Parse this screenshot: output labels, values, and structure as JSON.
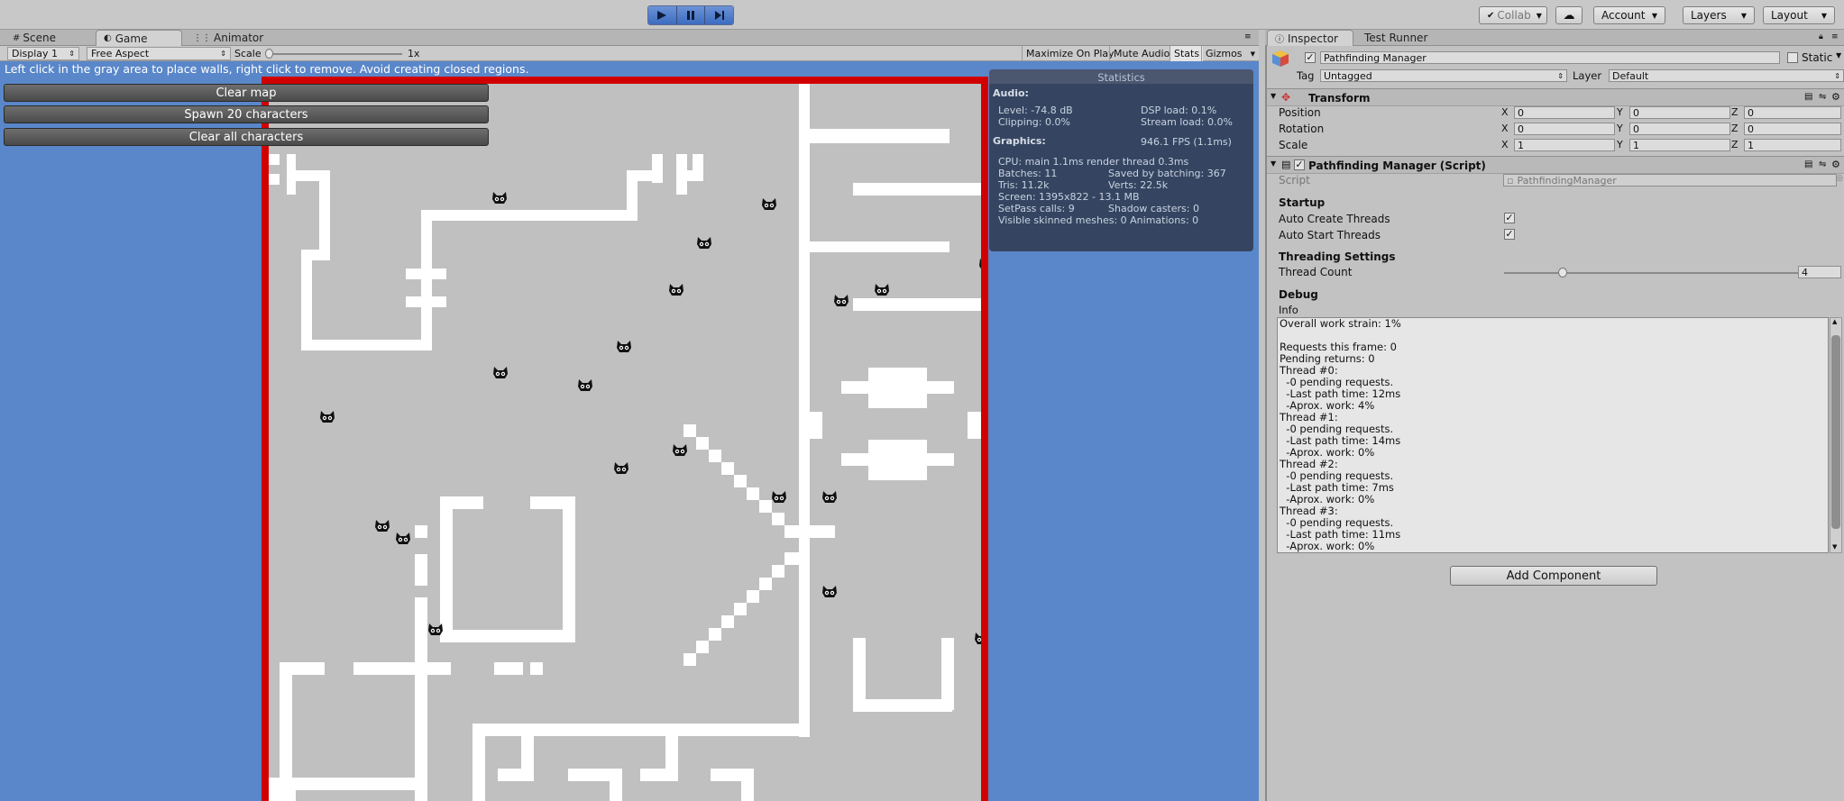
{
  "toolbar": {
    "collab": "Collab",
    "account": "Account",
    "layers": "Layers",
    "layout": "Layout",
    "play_icon": "play-icon",
    "pause_icon": "pause-icon",
    "step_icon": "step-icon"
  },
  "editor_tabs": [
    "Scene",
    "Game",
    "Animator"
  ],
  "game_toolbar": {
    "display": "Display 1",
    "aspect": "Free Aspect",
    "scale_label": "Scale",
    "scale_value": "1x",
    "maximize": "Maximize On Play",
    "mute": "Mute Audio",
    "stats": "Stats",
    "gizmos": "Gizmos"
  },
  "game": {
    "help_text": "Left click in the gray area to place walls, right click to remove. Avoid creating closed regions.",
    "buttons": [
      "Clear map",
      "Spawn 20 characters",
      "Clear all characters"
    ]
  },
  "stats": {
    "title": "Statistics",
    "audio_header": "Audio:",
    "level": "Level: -74.8 dB",
    "clipping": "Clipping: 0.0%",
    "dsp": "DSP load: 0.1%",
    "stream": "Stream load: 0.0%",
    "graphics_header": "Graphics:",
    "fps": "946.1 FPS (1.1ms)",
    "cpu": "CPU: main 1.1ms  render thread 0.3ms",
    "batches": "Batches: 11",
    "saved_batching": "Saved by batching: 367",
    "tris": "Tris: 11.2k",
    "verts": "Verts: 22.5k",
    "screen": "Screen: 1395x822 - 13.1 MB",
    "setpass": "SetPass calls: 9",
    "shadow": "Shadow casters: 0",
    "skinned": "Visible skinned meshes: 0  Animations: 0"
  },
  "inspector": {
    "tabs": [
      "Inspector",
      "Test Runner"
    ],
    "object_name": "Pathfinding Manager",
    "static_label": "Static",
    "tag_label": "Tag",
    "tag_value": "Untagged",
    "layer_label": "Layer",
    "layer_value": "Default",
    "transform": {
      "title": "Transform",
      "position_label": "Position",
      "rotation_label": "Rotation",
      "scale_label": "Scale",
      "position": [
        "0",
        "0",
        "0"
      ],
      "rotation": [
        "0",
        "0",
        "0"
      ],
      "scale": [
        "1",
        "1",
        "1"
      ],
      "axes": [
        "X",
        "Y",
        "Z"
      ]
    },
    "script_component": {
      "title": "Pathfinding Manager (Script)",
      "script_label": "Script",
      "script_value": "PathfindingManager",
      "startup_header": "Startup",
      "auto_create_label": "Auto Create Threads",
      "auto_create_checked": true,
      "auto_start_label": "Auto Start Threads",
      "auto_start_checked": true,
      "threading_header": "Threading Settings",
      "thread_count_label": "Thread Count",
      "thread_count_value": "4",
      "debug_header": "Debug",
      "info_label": "Info",
      "info_lines": [
        "Overall work strain: 1%",
        "",
        "Requests this frame: 0",
        "Pending returns: 0",
        "Thread #0:",
        "  -0 pending requests.",
        "  -Last path time: 12ms",
        "  -Aprox. work: 4%",
        "Thread #1:",
        "  -0 pending requests.",
        "  -Last path time: 14ms",
        "  -Aprox. work: 0%",
        "Thread #2:",
        "  -0 pending requests.",
        "  -Last path time: 7ms",
        "  -Aprox. work: 0%",
        "Thread #3:",
        "  -0 pending requests.",
        "  -Last path time: 11ms",
        "  -Aprox. work: 0%"
      ]
    },
    "add_component": "Add Component"
  },
  "colors": {
    "viewport": "#5a87c9",
    "map_border": "#d10000",
    "map_floor": "#c0c0c0",
    "walls": "#ffffff",
    "play_active": "#4a7bd0"
  }
}
